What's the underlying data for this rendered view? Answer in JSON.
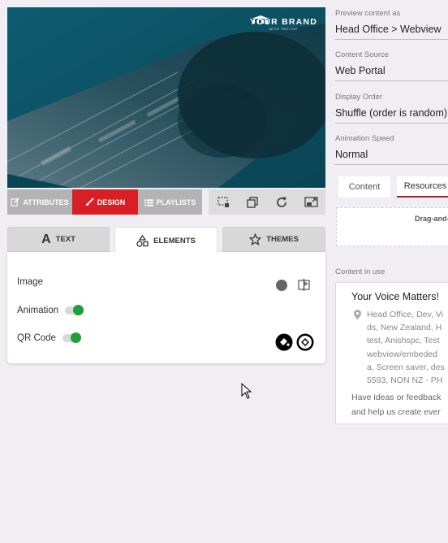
{
  "preview": {
    "brand_name": "YOUR BRAND",
    "brand_tagline": "WITH TAGLINE"
  },
  "mode_tabs": {
    "attributes": "ATTRIBUTES",
    "design": "DESIGN",
    "playlists": "PLAYLISTS",
    "active": "design",
    "active_color": "#d81f26"
  },
  "design_tabs": {
    "text": "TEXT",
    "elements": "ELEMENTS",
    "themes": "THEMES",
    "active": "elements"
  },
  "elements_panel": {
    "image_label": "Image",
    "animation_label": "Animation",
    "animation_on": true,
    "qr_label": "QR Code",
    "qr_on": true,
    "toggle_color": "#1e9e3c"
  },
  "settings": {
    "preview_as_label": "Preview content as",
    "preview_as_value": "Head Office > Webview",
    "content_source_label": "Content Source",
    "content_source_value": "Web Portal",
    "display_order_label": "Display Order",
    "display_order_value": "Shuffle (order is random)",
    "animation_speed_label": "Animation Speed",
    "animation_speed_value": "Normal"
  },
  "right_tabs": {
    "content": "Content",
    "resources": "Resources",
    "active": "resources"
  },
  "dropzone_text": "Drag-and-drop",
  "content_in_use": {
    "label": "Content in use",
    "title": "Your Voice Matters!",
    "location_lines": [
      "Head Office, Dev, Vi",
      "ds, New Zealand, H",
      "test, Anishspc, Test",
      "webview/embeded",
      "a, Screen saver, des",
      "5593, NON NZ - PH"
    ],
    "feedback_lines": [
      "Have ideas or feedback",
      "and help us create ever"
    ]
  }
}
